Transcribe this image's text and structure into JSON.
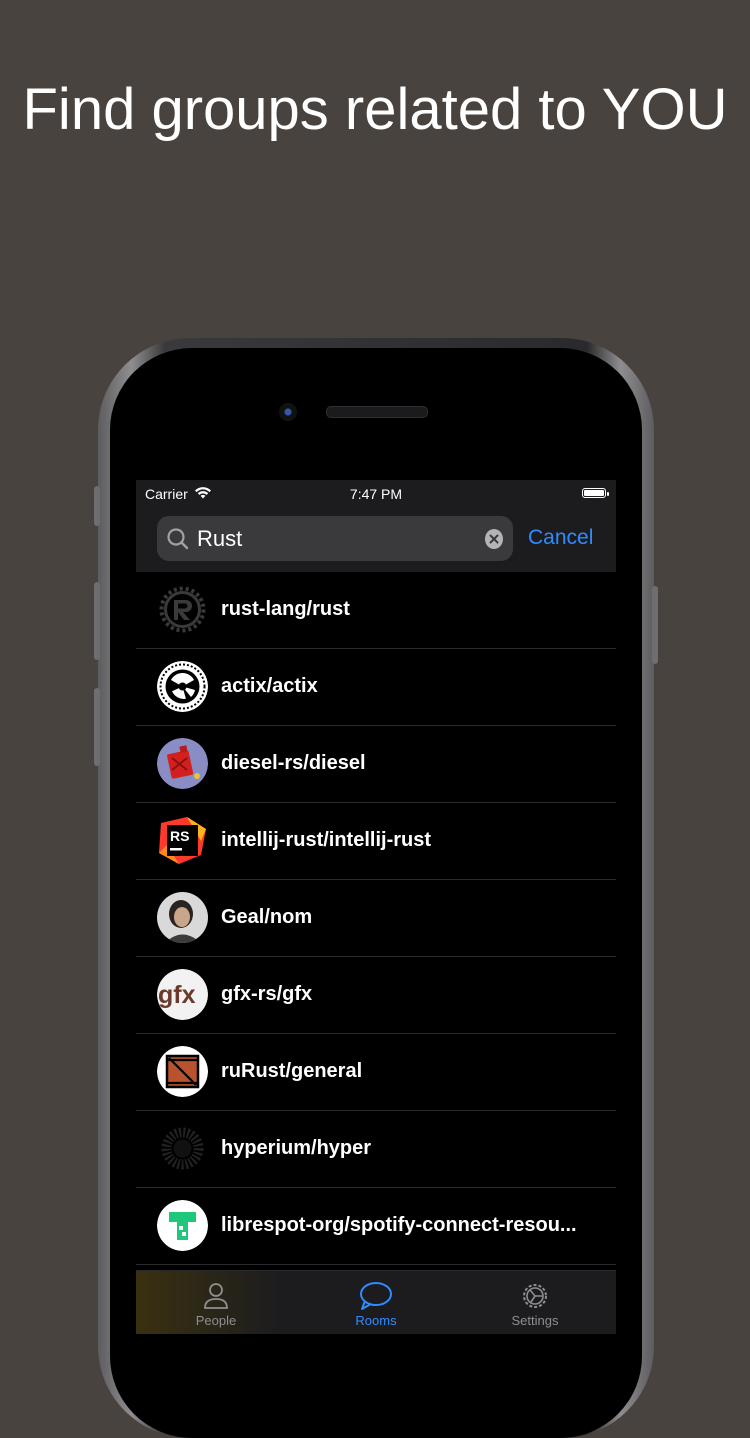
{
  "headline": "Find groups related to YOU",
  "status_bar": {
    "carrier": "Carrier",
    "time": "7:47 PM"
  },
  "search": {
    "value": "Rust",
    "cancel_label": "Cancel"
  },
  "rooms": [
    {
      "name": "rust-lang/rust",
      "icon": "rust-logo"
    },
    {
      "name": "actix/actix",
      "icon": "actix-logo"
    },
    {
      "name": "diesel-rs/diesel",
      "icon": "diesel-fuel-can-logo"
    },
    {
      "name": "intellij-rust/intellij-rust",
      "icon": "intellij-rs-logo"
    },
    {
      "name": "Geal/nom",
      "icon": "user-photo"
    },
    {
      "name": "gfx-rs/gfx",
      "icon": "gfx-logo"
    },
    {
      "name": "ruRust/general",
      "icon": "crate-logo"
    },
    {
      "name": "hyperium/hyper",
      "icon": "hyper-logo"
    },
    {
      "name": "librespot-org/spotify-connect-resou...",
      "icon": "librespot-logo"
    }
  ],
  "tabs": [
    {
      "label": "People",
      "icon": "person-icon",
      "active": false
    },
    {
      "label": "Rooms",
      "icon": "chat-bubble-icon",
      "active": true
    },
    {
      "label": "Settings",
      "icon": "gear-icon",
      "active": false
    }
  ],
  "colors": {
    "accent": "#2f8cff",
    "background": "#48433f"
  }
}
